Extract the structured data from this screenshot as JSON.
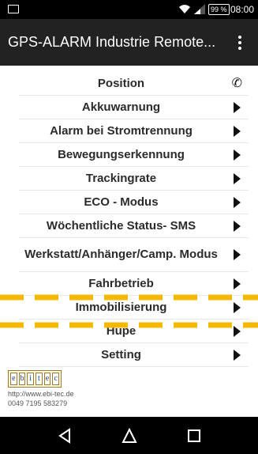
{
  "status_bar": {
    "battery": "99 %",
    "time": "08:00"
  },
  "app_bar": {
    "title": "GPS-ALARM Industrie Remote..."
  },
  "menu_items": [
    {
      "label": "Position",
      "indicator": "phone-icon"
    },
    {
      "label": "Akkuwarnung",
      "indicator": "arrow-right-icon"
    },
    {
      "label": "Alarm bei Stromtrennung",
      "indicator": "arrow-right-icon"
    },
    {
      "label": "Bewegungserkennung",
      "indicator": "arrow-right-icon"
    },
    {
      "label": "Trackingrate",
      "indicator": "arrow-right-icon"
    },
    {
      "label": "ECO - Modus",
      "indicator": "arrow-right-icon"
    },
    {
      "label": "Wöchentliche Status- SMS",
      "indicator": "arrow-right-icon"
    },
    {
      "label": "Werkstatt/Anhänger/Camp. Modus",
      "indicator": "arrow-right-icon"
    },
    {
      "label": "Fahrbetrieb",
      "indicator": "arrow-right-icon"
    },
    {
      "label": "Immobilisierung",
      "indicator": "arrow-right-icon"
    },
    {
      "label": "Hupe",
      "indicator": "arrow-right-icon"
    },
    {
      "label": "Setting",
      "indicator": "arrow-right-icon"
    }
  ],
  "footer": {
    "logo_letters": [
      "e",
      "b",
      "i",
      "t",
      "e",
      "c"
    ],
    "url": "http://www.ebi-tec.de",
    "phone": "0049 7195 583279"
  },
  "colors": {
    "app_bar": "#222222",
    "highlight_dash": "#f5b800",
    "arrow": "#111111"
  }
}
